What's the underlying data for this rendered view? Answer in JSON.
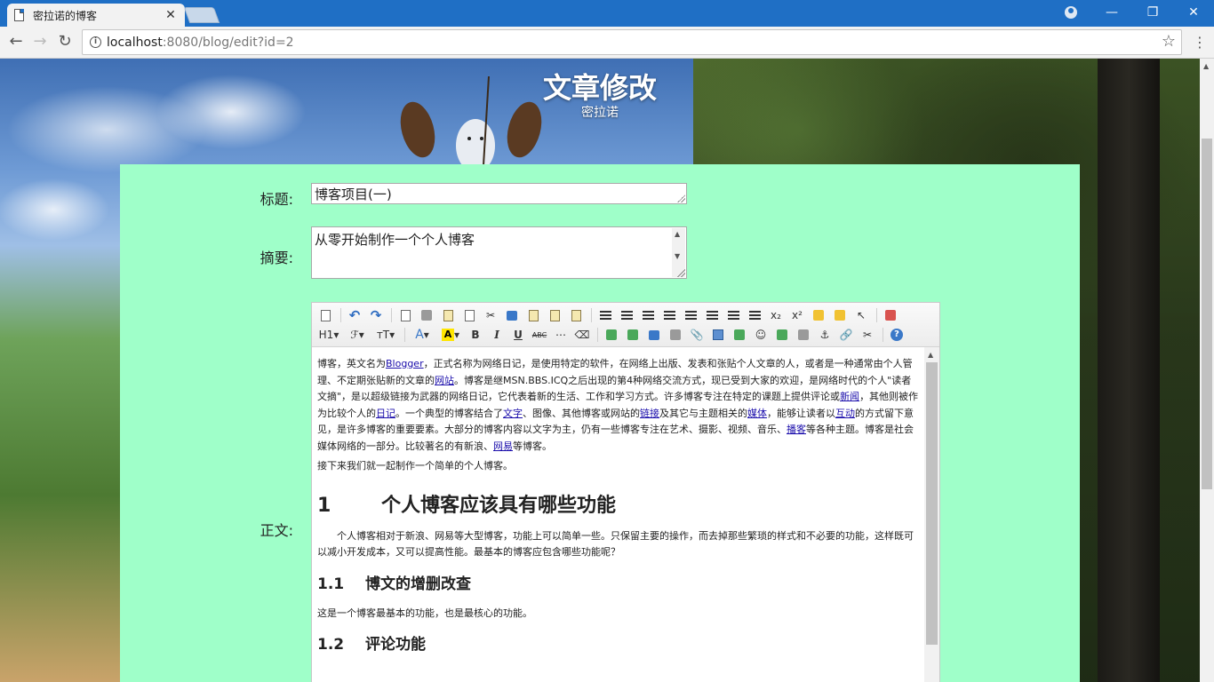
{
  "browser": {
    "tab_title": "密拉诺的博客",
    "url_host": "localhost",
    "url_rest": ":8080/blog/edit?id=2"
  },
  "header": {
    "title": "文章修改",
    "subtitle": "密拉诺"
  },
  "form": {
    "title_label": "标题:",
    "title_value": "博客项目(一)",
    "summary_label": "摘要:",
    "summary_value": "从零开始制作一个个人博客",
    "content_label": "正文:"
  },
  "editor": {
    "toolbar_labels": {
      "heading": "H1",
      "font": "ℱ",
      "size": "тT",
      "font_color": "A",
      "bold": "B",
      "italic": "I",
      "underline": "U",
      "strike": "ABC",
      "superscript": "x²",
      "subscript": "x₂",
      "help": "?"
    },
    "intro": {
      "t1": "博客，英文名为",
      "l1": "Blogger",
      "t2": "，正式名称为网络日记，是使用特定的软件，在网络上出版、发表和张贴个人文章的人，或者是一种通常由个人管理、不定期张贴新的文章的",
      "l2": "网站",
      "t3": "。博客是继MSN.BBS.ICQ之后出现的第4种网络交流方式，现已受到大家的欢迎，是网络时代的个人\"读者文摘\"，是以超级链接为武器的网络日记，它代表着新的生活、工作和学习方式。许多博客专注在特定的课题上提供评论或",
      "l3": "新闻",
      "t4": "，其他则被作为比较个人的",
      "l4": "日记",
      "t5": "。一个典型的博客结合了",
      "l5": "文字",
      "t6": "、图像、其他博客或网站的",
      "l6": "链接",
      "t7": "及其它与主题相关的",
      "l7": "媒体",
      "t8": "，能够让读者以",
      "l8": "互动",
      "t9": "的方式留下意见，是许多博客的重要要素。大部分的博客内容以文字为主，仍有一些博客专注在艺术、摄影、视频、音乐、",
      "l9": "播客",
      "t10": "等各种主题。博客是社会媒体网络的一部分。比较著名的有新浪、",
      "l10": "网易",
      "t11": "等博客。"
    },
    "next_line": "接下来我们就一起制作一个简单的个人博客。",
    "h1_num": "1",
    "h1_text": "个人博客应该具有哪些功能",
    "para1": "个人博客相对于新浪、网易等大型博客，功能上可以简单一些。只保留主要的操作，而去掉那些繁琐的样式和不必要的功能，这样既可以减小开发成本，又可以提高性能。最基本的博客应包含哪些功能呢？",
    "h11_num": "1.1",
    "h11_text": "博文的增删改查",
    "para2": "这是一个博客最基本的功能，也是最核心的功能。",
    "h12_num": "1.2",
    "h12_text": "评论功能"
  }
}
